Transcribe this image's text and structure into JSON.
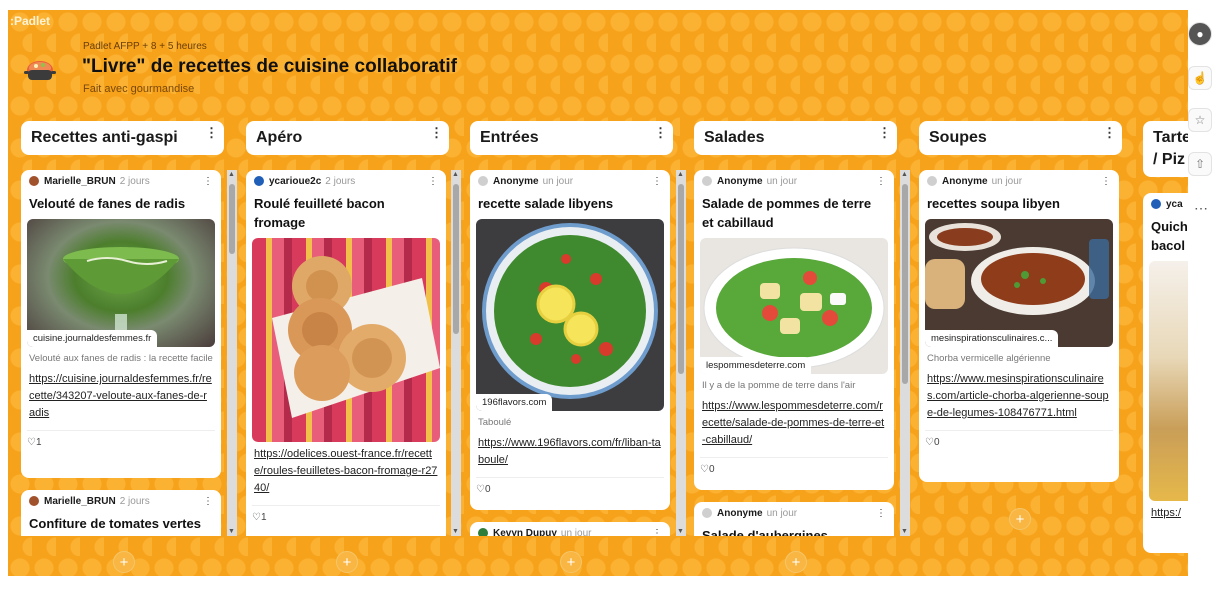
{
  "brand": ":Padlet",
  "board": {
    "meta": "Padlet AFPP + 8 + 5 heures",
    "title": "\"Livre\" de recettes de cuisine collaboratif",
    "subtitle": "Fait avec gourmandise"
  },
  "columns": [
    {
      "title": "Recettes anti-gaspi"
    },
    {
      "title": "Apéro"
    },
    {
      "title": "Entrées"
    },
    {
      "title": "Salades"
    },
    {
      "title": "Soupes"
    },
    {
      "title": "Tarte / Piz"
    }
  ],
  "cards": {
    "c1a": {
      "author": "Marielle_BRUN",
      "time": "2 jours",
      "title": "Velouté de fanes de radis",
      "domain": "cuisine.journaldesfemmes.fr",
      "desc": "Velouté aux fanes de radis : la recette facile",
      "link": "https://cuisine.journaldesfemmes.fr/recette/343207-veloute-aux-fanes-de-radis",
      "likes": "1"
    },
    "c1b": {
      "author": "Marielle_BRUN",
      "time": "2 jours",
      "title": "Confiture de tomates vertes"
    },
    "c2a": {
      "author": "ycarioue2c",
      "time": "2 jours",
      "title": "Roulé feuilleté bacon fromage",
      "link": "https://odelices.ouest-france.fr/recette/roules-feuilletes-bacon-fromage-r2740/",
      "likes": "1"
    },
    "c3a": {
      "author": "Anonyme",
      "time": "un jour",
      "title": "recette salade libyens",
      "domain": "196flavors.com",
      "desc": "Taboulé",
      "link": "https://www.196flavors.com/fr/liban-taboule/",
      "likes": "0"
    },
    "c3b": {
      "author": "Kevyn Dupuy",
      "time": "un jour"
    },
    "c4a": {
      "author": "Anonyme",
      "time": "un jour",
      "title": "Salade de pommes de terre et cabillaud",
      "domain": "lespommesdeterre.com",
      "desc": "Il y a de la pomme de terre dans l'air",
      "link": "https://www.lespommesdeterre.com/recette/salade-de-pommes-de-terre-et-cabillaud/",
      "likes": "0"
    },
    "c4b": {
      "author": "Anonyme",
      "time": "un jour",
      "title": "Salade d'aubergines"
    },
    "c5a": {
      "author": "Anonyme",
      "time": "un jour",
      "title": "recettes soupa libyen",
      "domain": "mesinspirationsculinaires.c...",
      "desc": "Chorba vermicelle algérienne",
      "link": "https://www.mesinspirationsculinaires.com/article-chorba-algerienne-soupe-de-legumes-108476771.html",
      "likes": "0"
    },
    "c6a": {
      "author": "yca",
      "title": "Quich bacol",
      "link": "https:/"
    }
  },
  "icons": {
    "menu": "⋮",
    "heart": "♡",
    "add": "+",
    "more": "⋯"
  },
  "colors": {
    "board_bg": "#f7a21b",
    "hex": "#fbb233",
    "card_bg": "#ffffff"
  }
}
